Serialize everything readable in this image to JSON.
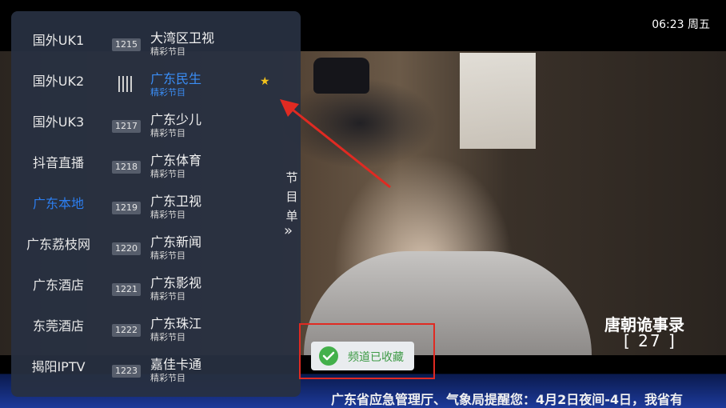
{
  "clock": "06:23 周五",
  "player": {
    "show_title": "唐朝诡事录",
    "episode": "[ 27 ]",
    "ticker": "广东省应急管理厅、气象局提醒您：4月2日夜间-4日，我省有"
  },
  "groups": [
    {
      "label": "国外UK1",
      "active": false
    },
    {
      "label": "国外UK2",
      "active": false
    },
    {
      "label": "国外UK3",
      "active": false
    },
    {
      "label": "抖音直播",
      "active": false
    },
    {
      "label": "广东本地",
      "active": true
    },
    {
      "label": "广东荔枝网",
      "active": false
    },
    {
      "label": "广东酒店",
      "active": false
    },
    {
      "label": "东莞酒店",
      "active": false
    },
    {
      "label": "揭阳IPTV",
      "active": false
    }
  ],
  "channels": [
    {
      "num": "1215",
      "name": "大湾区卫视",
      "sub": "精彩节目"
    },
    {
      "num": "",
      "name": "广东民生",
      "sub": "精彩节目",
      "playing": true,
      "favorite": true
    },
    {
      "num": "1217",
      "name": "广东少儿",
      "sub": "精彩节目"
    },
    {
      "num": "1218",
      "name": "广东体育",
      "sub": "精彩节目"
    },
    {
      "num": "1219",
      "name": "广东卫视",
      "sub": "精彩节目"
    },
    {
      "num": "1220",
      "name": "广东新闻",
      "sub": "精彩节目"
    },
    {
      "num": "1221",
      "name": "广东影视",
      "sub": "精彩节目"
    },
    {
      "num": "1222",
      "name": "广东珠江",
      "sub": "精彩节目"
    },
    {
      "num": "1223",
      "name": "嘉佳卡通",
      "sub": "精彩节目"
    }
  ],
  "epg_tab": {
    "chars": [
      "节",
      "目",
      "单"
    ],
    "arrow": "»"
  },
  "toast": {
    "text": "频道已收藏"
  },
  "colors": {
    "accent": "#2c7ef0",
    "favorite": "#f2c21b",
    "toast_check": "#43b04b",
    "annotation": "#e02a22"
  }
}
